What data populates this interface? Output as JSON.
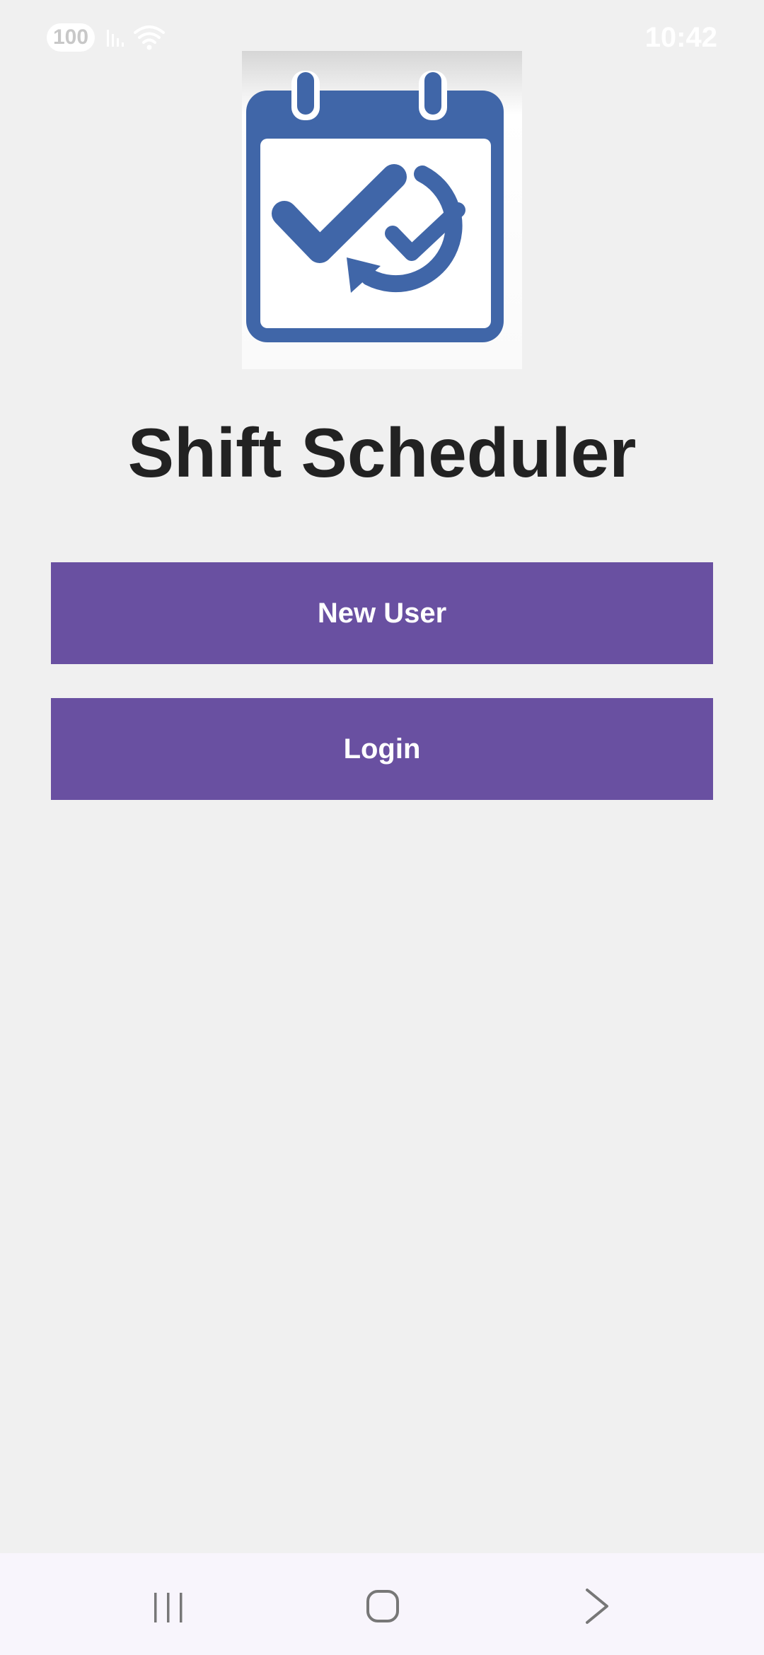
{
  "status_bar": {
    "battery": "100",
    "time": "10:42"
  },
  "app": {
    "title": "Shift Scheduler"
  },
  "buttons": {
    "new_user": "New User",
    "login": "Login"
  },
  "colors": {
    "background": "#f0f0f0",
    "button": "#6950a1",
    "button_text": "#ffffff",
    "title_text": "#222222",
    "logo_blue": "#4066a8"
  },
  "icons": {
    "logo": "calendar-check-refresh-icon",
    "signal": "signal-icon",
    "wifi": "wifi-icon",
    "nav_recents": "recents-icon",
    "nav_home": "home-icon",
    "nav_back": "back-icon"
  }
}
